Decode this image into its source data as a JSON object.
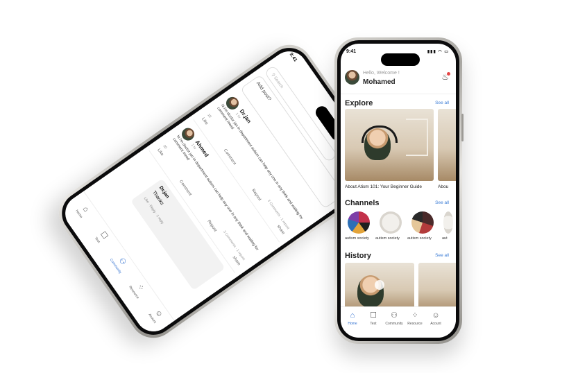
{
  "right_phone": {
    "status": {
      "time": "9:41",
      "icons": "▮▮▮ ◠ ▭"
    },
    "header": {
      "greeting": "Hello, Welcome !",
      "user_name": "Mohamed"
    },
    "explore": {
      "title": "Explore",
      "see_all": "See all",
      "items": [
        {
          "caption": "About Atism 101: Your Beginner Guide"
        },
        {
          "caption": "Abou"
        }
      ]
    },
    "channels": {
      "title": "Channels",
      "see_all": "See all",
      "items": [
        {
          "label": "autism society"
        },
        {
          "label": "autism society"
        },
        {
          "label": "autism society"
        },
        {
          "label": "aut"
        }
      ]
    },
    "history": {
      "title": "History",
      "see_all": "See all"
    },
    "nav": [
      {
        "label": "Home",
        "icon": "home-icon",
        "glyph": "⌂"
      },
      {
        "label": "Test",
        "icon": "test-icon",
        "glyph": "☐"
      },
      {
        "label": "Community",
        "icon": "community-icon",
        "glyph": "⚇"
      },
      {
        "label": "Resource",
        "icon": "resource-icon",
        "glyph": "⁘"
      },
      {
        "label": "Acount",
        "icon": "account-icon",
        "glyph": "☺"
      }
    ],
    "accent": "#2f6fd0"
  },
  "left_phone": {
    "status": {
      "time": "9:41"
    },
    "search_placeholder": "Search",
    "add_post_placeholder": "Add post?",
    "posts": [
      {
        "name": "Dr.jan",
        "time": "1 hr",
        "text": "hi i'm doctor jan in department autism can help any one in any think and waiting for comment /need",
        "reactions": "10",
        "meta": "3 Comments  · 1 repost",
        "like": "Like",
        "comment": "Comment",
        "repost": "Repost",
        "share": "share"
      },
      {
        "name": "Ahmed",
        "time": "1 hr",
        "text": "hi i'm doctor jan in department autism can help any one in any think and waiting for comment /need",
        "reactions": "10",
        "meta": "3 Comments  · 1 repost",
        "like": "Like",
        "comment": "Comment",
        "repost": "Repost",
        "share": "share"
      }
    ],
    "reply": {
      "name": "Dr.jan",
      "text": "Thanks",
      "actions": "Like · Reply · 1 reply"
    },
    "nav": [
      {
        "label": "Home"
      },
      {
        "label": "Test"
      },
      {
        "label": "Community"
      },
      {
        "label": "Resource"
      },
      {
        "label": "Acount"
      }
    ]
  }
}
